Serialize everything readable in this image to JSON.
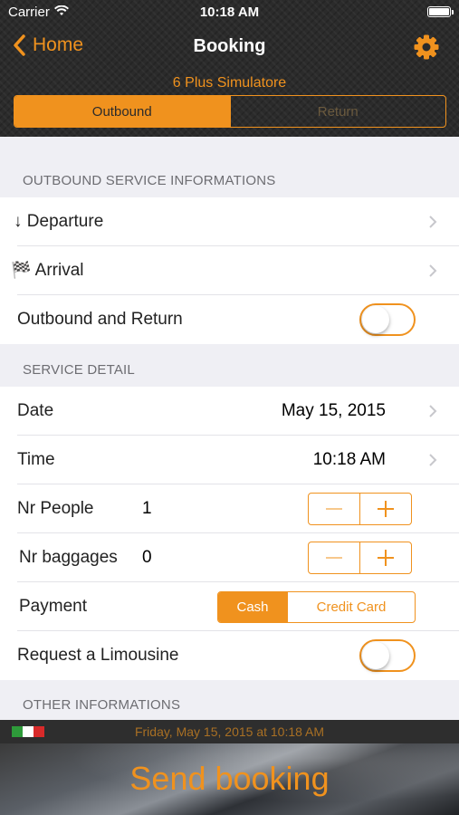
{
  "status": {
    "carrier": "Carrier",
    "time": "10:18 AM"
  },
  "nav": {
    "back": "Home",
    "title": "Booking",
    "settings_icon": "gear-icon"
  },
  "subtitle": "6 Plus Simulatore",
  "segment": {
    "outbound": "Outbound",
    "return": "Return",
    "selected": "Outbound"
  },
  "section1": {
    "header": "OUTBOUND SERVICE INFORMATIONS",
    "departure": "Departure",
    "departure_icon": "↓",
    "arrival": "Arrival",
    "arrival_icon": "🏁",
    "outbound_return": "Outbound and Return",
    "outbound_return_on": false
  },
  "section2": {
    "header": "SERVICE DETAIL",
    "date_label": "Date",
    "date_value": "May 15, 2015",
    "time_label": "Time",
    "time_value": "10:18 AM",
    "people_label": "Nr People",
    "people_value": "1",
    "baggages_label": "Nr baggages",
    "baggages_value": "0",
    "payment_label": "Payment",
    "payment_cash": "Cash",
    "payment_card": "Credit Card",
    "payment_selected": "Cash",
    "limousine_label": "Request a Limousine",
    "limousine_on": false
  },
  "section3": {
    "header": "OTHER INFORMATIONS"
  },
  "footer": {
    "date_text": "Friday, May 15, 2015 at 10:18 AM",
    "flag_colors": [
      "#2e9b3a",
      "#ffffff",
      "#d82a2a"
    ],
    "send_label": "Send booking"
  },
  "colors": {
    "accent": "#f0921e",
    "dark": "#2b2b2b"
  }
}
